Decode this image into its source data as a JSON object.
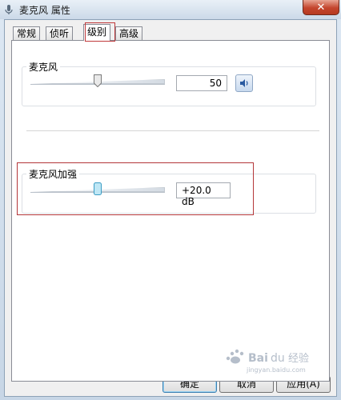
{
  "window": {
    "title": "麦克风 属性"
  },
  "tabs": [
    {
      "label": "常规",
      "active": false
    },
    {
      "label": "侦听",
      "active": false
    },
    {
      "label": "级别",
      "active": true
    },
    {
      "label": "高级",
      "active": false
    }
  ],
  "microphone": {
    "label": "麦克风",
    "value": "50",
    "level": 0.5
  },
  "boost": {
    "label": "麦克风加强",
    "value": "+20.0 dB",
    "level": 0.5
  },
  "buttons": {
    "ok": "确定",
    "cancel": "取消",
    "apply": "应用(A)"
  },
  "watermark": {
    "text": "Baidu经验",
    "url": "jingyan.baidu.com"
  },
  "colors": {
    "annotation_red": "#b43639",
    "accent": "#3c7fb1"
  }
}
